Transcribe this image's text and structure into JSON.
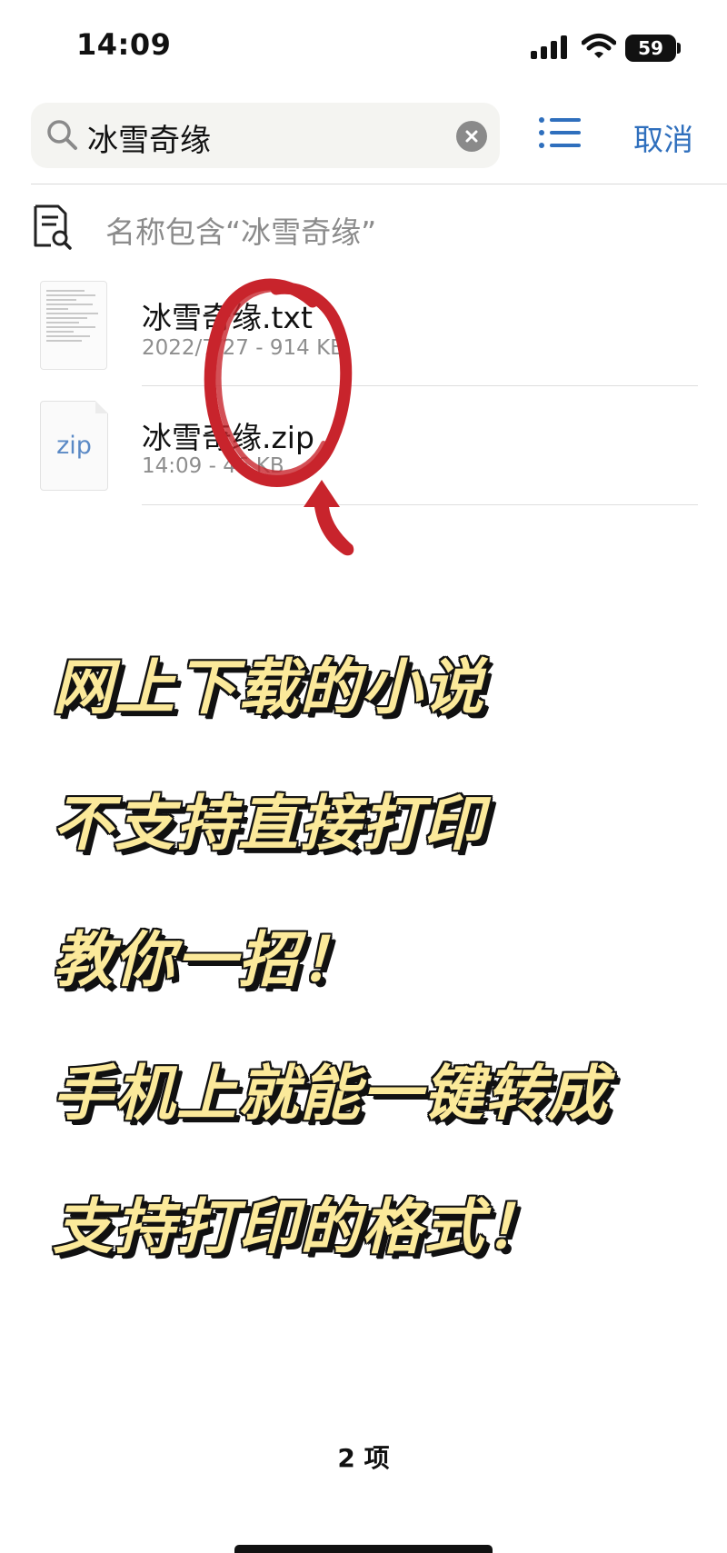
{
  "status_bar": {
    "time": "14:09",
    "battery": "59",
    "icons": [
      "signal-icon",
      "wifi-icon",
      "battery-icon"
    ]
  },
  "search": {
    "query": "冰雪奇缘",
    "cancel_label": "取消",
    "icons": [
      "search-icon",
      "clear-icon",
      "list-view-icon"
    ]
  },
  "filter": {
    "label": "名称包含“冰雪奇缘”",
    "icon": "document-search-icon"
  },
  "files": [
    {
      "name": "冰雪奇缘.txt",
      "meta": "2022/7/27 - 914 KB",
      "thumb": "text-document-thumbnail"
    },
    {
      "name": "冰雪奇缘.zip",
      "meta": "14:09 - 46 KB",
      "thumb_label": "zip"
    }
  ],
  "promo_lines": [
    "网上下载的小说",
    "不支持直接打印",
    "教你一招！",
    "手机上就能一键转成",
    "支持打印的格式！"
  ],
  "footer": {
    "count": "2 项"
  },
  "colors": {
    "accent": "#2f6fbd",
    "annotation": "#c8242c",
    "promo_fill": "#fbe99a",
    "promo_outline": "#111111"
  }
}
